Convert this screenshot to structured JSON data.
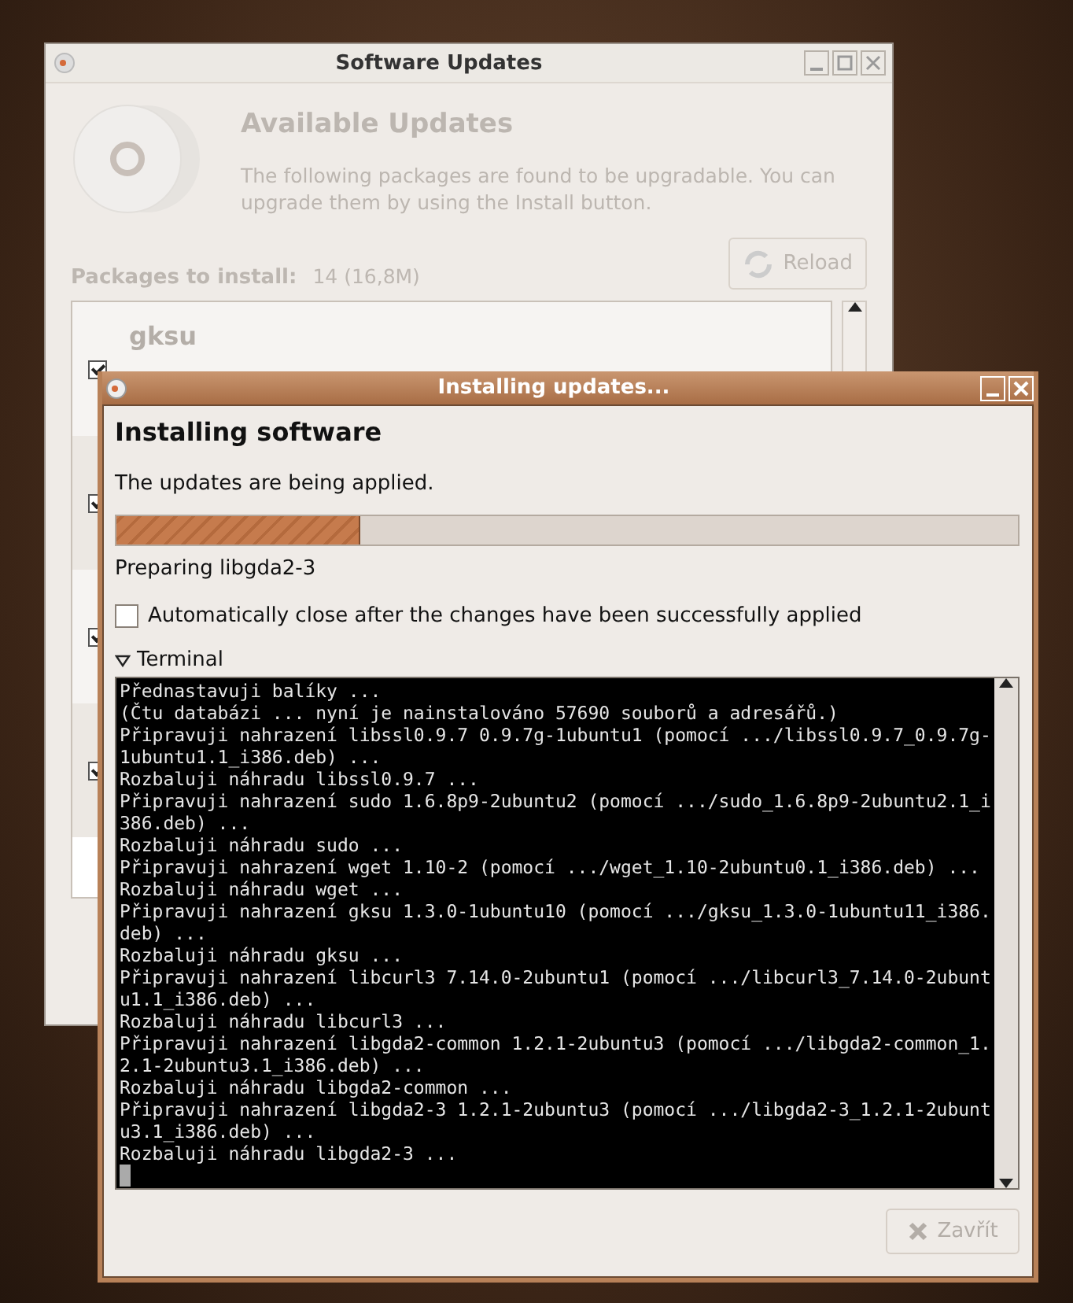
{
  "back_window": {
    "title": "Software Updates",
    "heading": "Available Updates",
    "description": "The following packages are found to be upgradable. You can upgrade them by using the Install button.",
    "reload_button": "Reload",
    "packages_label": "Packages to install:",
    "packages_count": "14 (16,8M)",
    "packages": [
      {
        "name": "gksu",
        "checked": true
      },
      {
        "checked": true
      },
      {
        "checked": true
      },
      {
        "checked": true
      }
    ]
  },
  "dialog": {
    "title": "Installing updates...",
    "heading": "Installing software",
    "message": "The updates are being applied.",
    "progress": {
      "level": 0.27
    },
    "status": "Preparing libgda2-3",
    "auto_close": {
      "label": "Automatically close after the changes have been successfully applied",
      "checked": false
    },
    "terminal": {
      "label": "Terminal",
      "expanded": true,
      "lines": [
        "Přednastavuji balíky ...",
        "(Čtu databázi ... nyní je nainstalováno 57690 souborů a adresářů.)",
        "Připravuji nahrazení libssl0.9.7 0.9.7g-1ubuntu1 (pomocí .../libssl0.9.7_0.9.7g-",
        "1ubuntu1.1_i386.deb) ...",
        "Rozbaluji náhradu libssl0.9.7 ...",
        "Připravuji nahrazení sudo 1.6.8p9-2ubuntu2 (pomocí .../sudo_1.6.8p9-2ubuntu2.1_i",
        "386.deb) ...",
        "Rozbaluji náhradu sudo ...",
        "Připravuji nahrazení wget 1.10-2 (pomocí .../wget_1.10-2ubuntu0.1_i386.deb) ...",
        "Rozbaluji náhradu wget ...",
        "Připravuji nahrazení gksu 1.3.0-1ubuntu10 (pomocí .../gksu_1.3.0-1ubuntu11_i386.",
        "deb) ...",
        "Rozbaluji náhradu gksu ...",
        "Připravuji nahrazení libcurl3 7.14.0-2ubuntu1 (pomocí .../libcurl3_7.14.0-2ubunt",
        "u1.1_i386.deb) ...",
        "Rozbaluji náhradu libcurl3 ...",
        "Připravuji nahrazení libgda2-common 1.2.1-2ubuntu3 (pomocí .../libgda2-common_1.",
        "2.1-2ubuntu3.1_i386.deb) ...",
        "Rozbaluji náhradu libgda2-common ...",
        "Připravuji nahrazení libgda2-3 1.2.1-2ubuntu3 (pomocí .../libgda2-3_1.2.1-2ubunt",
        "u3.1_i386.deb) ...",
        "Rozbaluji náhradu libgda2-3 ..."
      ]
    },
    "close_button": {
      "label": "Zavřít",
      "disabled": true
    }
  }
}
